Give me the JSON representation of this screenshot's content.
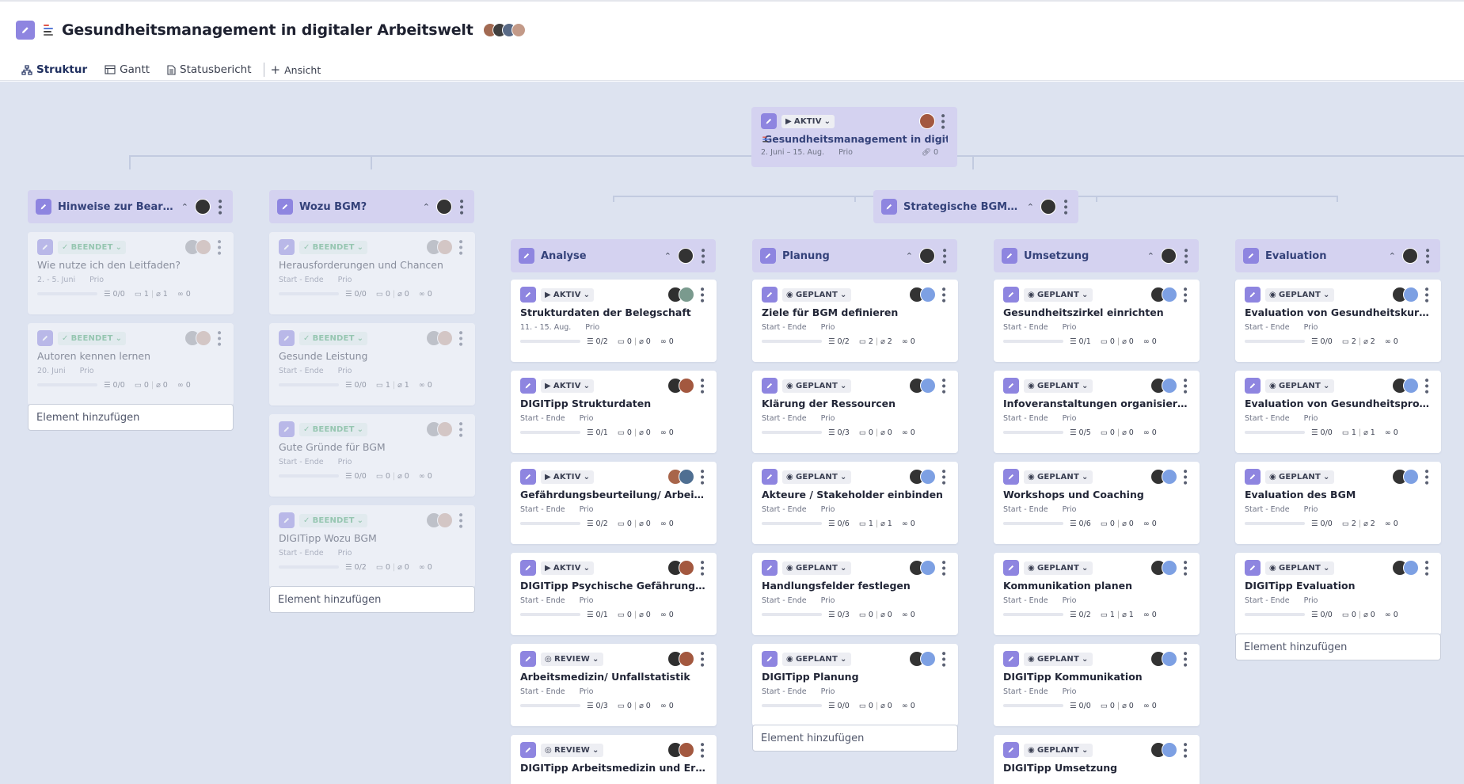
{
  "header": {
    "title": "Gesundheitsmanagement in digitaler Arbeitswelt",
    "tabs": [
      {
        "label": "Struktur",
        "icon": "hierarchy-icon",
        "active": true
      },
      {
        "label": "Gantt",
        "icon": "gantt-icon",
        "active": false
      },
      {
        "label": "Statusbericht",
        "icon": "document-icon",
        "active": false
      }
    ],
    "add_view_label": "Ansicht"
  },
  "colors": {
    "accent": "#8e85e0",
    "canvas": "#dde3f0",
    "group_bg": "#d4d2f0",
    "done_green": "#42a466",
    "tab_underline": "#2d4a8a"
  },
  "root": {
    "status": "AKTIV",
    "title": "Gesundheitsmanagement in digita...",
    "date": "2. Juni – 15. Aug.",
    "prio": "Prio",
    "links": "0"
  },
  "groups": {
    "hinweise": "Hinweise zur Bearbei...",
    "wozu": "Wozu BGM?",
    "strategische": "Strategische BGM-Pr...",
    "analyse": "Analyse",
    "planung": "Planung",
    "umsetzung": "Umsetzung",
    "evaluation": "Evaluation"
  },
  "add_element_label": "Element hinzufügen",
  "columns": {
    "hinweise": [
      {
        "status": "BEENDET",
        "title": "Wie nutze ich den Leitfaden?",
        "date": "2. - 5. Juni",
        "prio": "Prio",
        "tasks": "0/0",
        "comments": "1",
        "attachments": "1",
        "links": "0"
      },
      {
        "status": "BEENDET",
        "title": "Autoren kennen lernen",
        "date": "20. Juni",
        "prio": "Prio",
        "tasks": "0/0",
        "comments": "0",
        "attachments": "0",
        "links": "0"
      }
    ],
    "wozu": [
      {
        "status": "BEENDET",
        "title": "Herausforderungen und Chancen",
        "date": "Start - Ende",
        "prio": "Prio",
        "tasks": "0/0",
        "comments": "0",
        "attachments": "0",
        "links": "0"
      },
      {
        "status": "BEENDET",
        "title": "Gesunde Leistung",
        "date": "Start - Ende",
        "prio": "Prio",
        "tasks": "0/0",
        "comments": "1",
        "attachments": "1",
        "links": "0"
      },
      {
        "status": "BEENDET",
        "title": "Gute Gründe für BGM",
        "date": "Start - Ende",
        "prio": "Prio",
        "tasks": "0/0",
        "comments": "0",
        "attachments": "0",
        "links": "0"
      },
      {
        "status": "BEENDET",
        "title": "DIGITipp Wozu BGM",
        "date": "Start - Ende",
        "prio": "Prio",
        "tasks": "0/2",
        "comments": "0",
        "attachments": "0",
        "links": "0"
      }
    ],
    "analyse": [
      {
        "status": "AKTIV",
        "title": "Strukturdaten der Belegschaft",
        "date": "11. - 15. Aug.",
        "prio": "Prio",
        "tasks": "0/2",
        "comments": "0",
        "attachments": "0",
        "links": "0"
      },
      {
        "status": "AKTIV",
        "title": "DIGITipp Strukturdaten",
        "date": "Start - Ende",
        "prio": "Prio",
        "tasks": "0/1",
        "comments": "0",
        "attachments": "0",
        "links": "0"
      },
      {
        "status": "AKTIV",
        "title": "Gefährdungsbeurteilung/ Arbeitspla...",
        "date": "Start - Ende",
        "prio": "Prio",
        "tasks": "0/2",
        "comments": "0",
        "attachments": "0",
        "links": "0"
      },
      {
        "status": "AKTIV",
        "title": "DIGITipp Psychische Gefährungsbeur...",
        "date": "Start - Ende",
        "prio": "Prio",
        "tasks": "0/1",
        "comments": "0",
        "attachments": "0",
        "links": "0"
      },
      {
        "status": "REVIEW",
        "title": "Arbeitsmedizin/ Unfallstatistik",
        "date": "Start - Ende",
        "prio": "Prio",
        "tasks": "0/3",
        "comments": "0",
        "attachments": "0",
        "links": "0"
      },
      {
        "status": "REVIEW",
        "title": "DIGITipp Arbeitsmedizin und Ergono...",
        "date": "",
        "prio": "",
        "tasks": "",
        "comments": "",
        "attachments": "",
        "links": ""
      }
    ],
    "planung": [
      {
        "status": "GEPLANT",
        "title": "Ziele für BGM definieren",
        "date": "Start - Ende",
        "prio": "Prio",
        "tasks": "0/2",
        "comments": "2",
        "attachments": "2",
        "links": "0"
      },
      {
        "status": "GEPLANT",
        "title": "Klärung der Ressourcen",
        "date": "Start - Ende",
        "prio": "Prio",
        "tasks": "0/3",
        "comments": "0",
        "attachments": "0",
        "links": "0"
      },
      {
        "status": "GEPLANT",
        "title": "Akteure / Stakeholder einbinden",
        "date": "Start - Ende",
        "prio": "Prio",
        "tasks": "0/6",
        "comments": "1",
        "attachments": "1",
        "links": "0"
      },
      {
        "status": "GEPLANT",
        "title": "Handlungsfelder festlegen",
        "date": "Start - Ende",
        "prio": "Prio",
        "tasks": "0/3",
        "comments": "0",
        "attachments": "0",
        "links": "0"
      },
      {
        "status": "GEPLANT",
        "title": "DIGITipp Planung",
        "date": "Start - Ende",
        "prio": "Prio",
        "tasks": "0/0",
        "comments": "0",
        "attachments": "0",
        "links": "0"
      }
    ],
    "umsetzung": [
      {
        "status": "GEPLANT",
        "title": "Gesundheitszirkel einrichten",
        "date": "Start - Ende",
        "prio": "Prio",
        "tasks": "0/1",
        "comments": "0",
        "attachments": "0",
        "links": "0"
      },
      {
        "status": "GEPLANT",
        "title": "Infoveranstaltungen organisieren",
        "date": "Start - Ende",
        "prio": "Prio",
        "tasks": "0/5",
        "comments": "0",
        "attachments": "0",
        "links": "0"
      },
      {
        "status": "GEPLANT",
        "title": "Workshops und Coaching",
        "date": "Start - Ende",
        "prio": "Prio",
        "tasks": "0/6",
        "comments": "0",
        "attachments": "0",
        "links": "0"
      },
      {
        "status": "GEPLANT",
        "title": "Kommunikation planen",
        "date": "Start - Ende",
        "prio": "Prio",
        "tasks": "0/2",
        "comments": "1",
        "attachments": "1",
        "links": "0"
      },
      {
        "status": "GEPLANT",
        "title": "DIGITipp Kommunikation",
        "date": "Start - Ende",
        "prio": "Prio",
        "tasks": "0/0",
        "comments": "0",
        "attachments": "0",
        "links": "0"
      },
      {
        "status": "GEPLANT",
        "title": "DIGITipp Umsetzung",
        "date": "",
        "prio": "",
        "tasks": "",
        "comments": "",
        "attachments": "",
        "links": ""
      }
    ],
    "evaluation": [
      {
        "status": "GEPLANT",
        "title": "Evaluation von Gesundheitskursen",
        "date": "Start - Ende",
        "prio": "Prio",
        "tasks": "0/0",
        "comments": "2",
        "attachments": "2",
        "links": "0"
      },
      {
        "status": "GEPLANT",
        "title": "Evaluation von Gesundheitsprojekten",
        "date": "Start - Ende",
        "prio": "Prio",
        "tasks": "0/0",
        "comments": "1",
        "attachments": "1",
        "links": "0"
      },
      {
        "status": "GEPLANT",
        "title": "Evaluation des BGM",
        "date": "Start - Ende",
        "prio": "Prio",
        "tasks": "0/0",
        "comments": "2",
        "attachments": "2",
        "links": "0"
      },
      {
        "status": "GEPLANT",
        "title": "DIGITipp Evaluation",
        "date": "Start - Ende",
        "prio": "Prio",
        "tasks": "0/0",
        "comments": "0",
        "attachments": "0",
        "links": "0"
      }
    ]
  }
}
